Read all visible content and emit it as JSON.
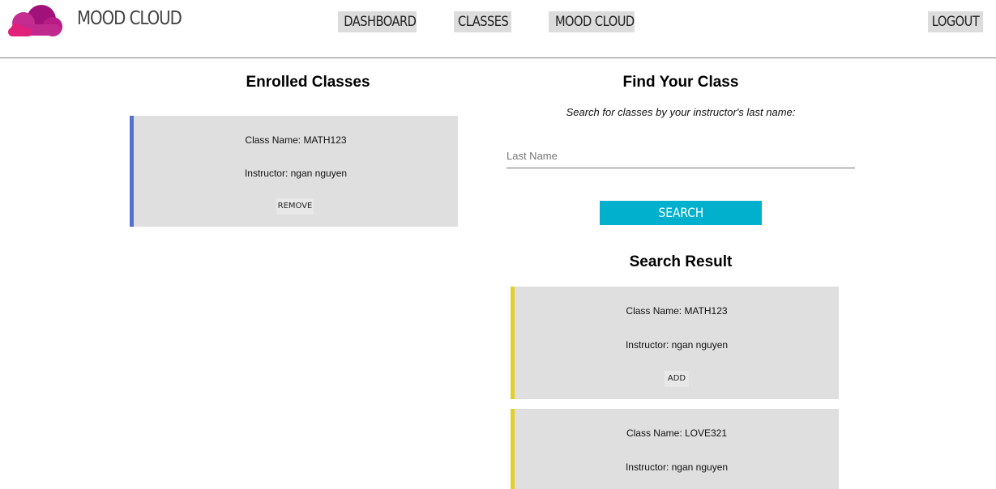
{
  "brand": {
    "name": "MOOD CLOUD",
    "colors": {
      "cloud_dark": "#a0127a",
      "cloud_light": "#c93ea0",
      "cloud_pink": "#e0207a"
    }
  },
  "nav": {
    "dashboard": "DASHBOARD",
    "classes": "CLASSES",
    "mood_cloud": "MOOD CLOUD",
    "logout": "LOGOUT"
  },
  "enrolled": {
    "title": "Enrolled Classes",
    "accent": "#5472cc",
    "cards": [
      {
        "class_name": "Class Name: MATH123",
        "instructor": "Instructor: ngan nguyen",
        "action": "REMOVE"
      }
    ]
  },
  "find": {
    "title": "Find Your Class",
    "subtitle": "Search for classes by your instructor's last name:",
    "placeholder": "Last Name",
    "search_label": "SEARCH",
    "search_color": "#00b0cc"
  },
  "results": {
    "title": "Search Result",
    "accent": "#e4cf2a",
    "cards": [
      {
        "class_name": "Class Name: MATH123",
        "instructor": "Instructor: ngan nguyen",
        "action": "ADD"
      },
      {
        "class_name": "Class Name: LOVE321",
        "instructor": "Instructor: ngan nguyen"
      }
    ]
  }
}
